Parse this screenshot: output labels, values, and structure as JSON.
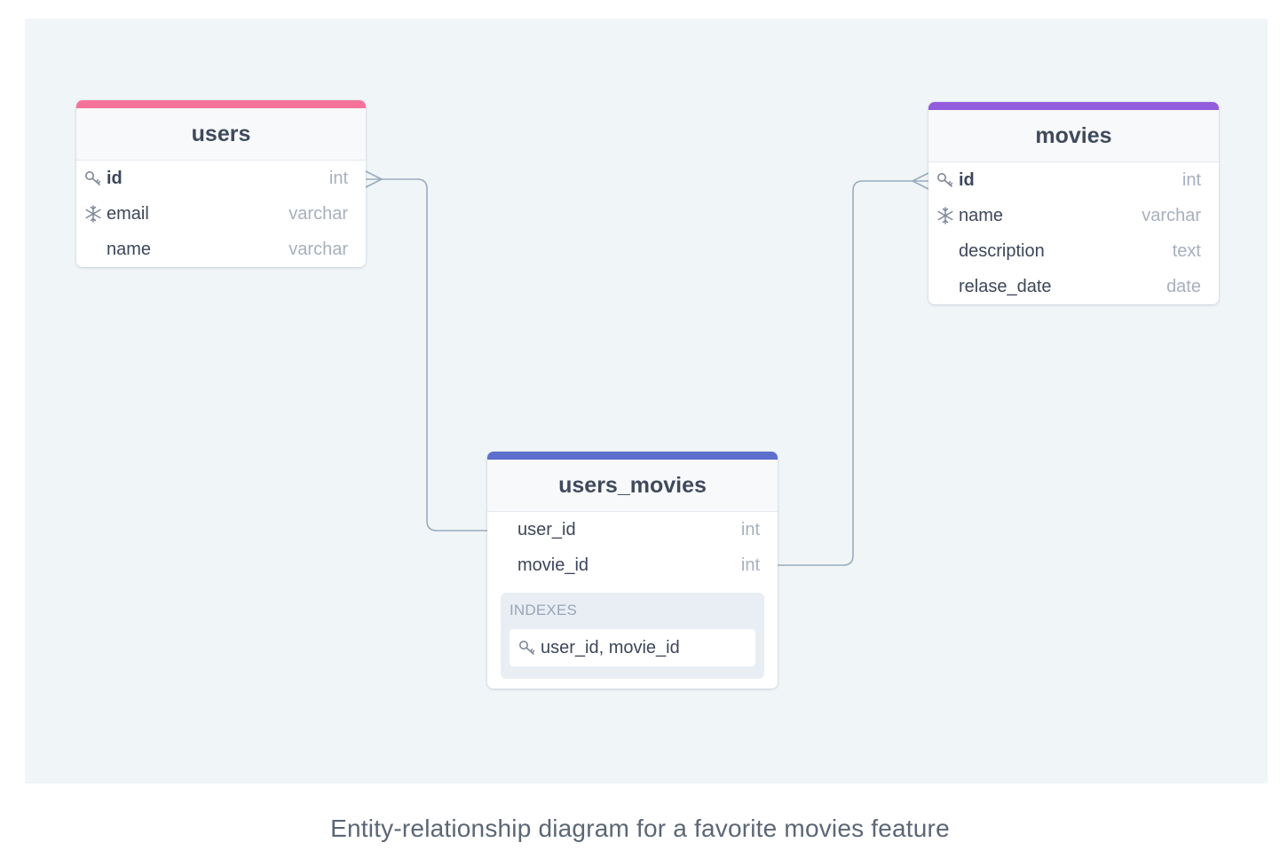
{
  "tables": {
    "users": {
      "name": "users",
      "accent": "#f5739b",
      "fields": [
        {
          "name": "id",
          "type": "int",
          "icon": "key-icon"
        },
        {
          "name": "email",
          "type": "varchar",
          "icon": "snowflake-icon"
        },
        {
          "name": "name",
          "type": "varchar",
          "icon": ""
        }
      ]
    },
    "movies": {
      "name": "movies",
      "accent": "#925ddc",
      "fields": [
        {
          "name": "id",
          "type": "int",
          "icon": "key-icon"
        },
        {
          "name": "name",
          "type": "varchar",
          "icon": "snowflake-icon"
        },
        {
          "name": "description",
          "type": "text",
          "icon": ""
        },
        {
          "name": "relase_date",
          "type": "date",
          "icon": ""
        }
      ]
    },
    "users_movies": {
      "name": "users_movies",
      "accent": "#5c6fcc",
      "fields": [
        {
          "name": "user_id",
          "type": "int"
        },
        {
          "name": "movie_id",
          "type": "int"
        }
      ],
      "indexes_label": "INDEXES",
      "index": "user_id, movie_id"
    }
  },
  "caption": "Entity-relationship diagram for a favorite movies feature",
  "colors": {
    "canvas": "#f0f5f8",
    "connector": "#9aabbe"
  }
}
